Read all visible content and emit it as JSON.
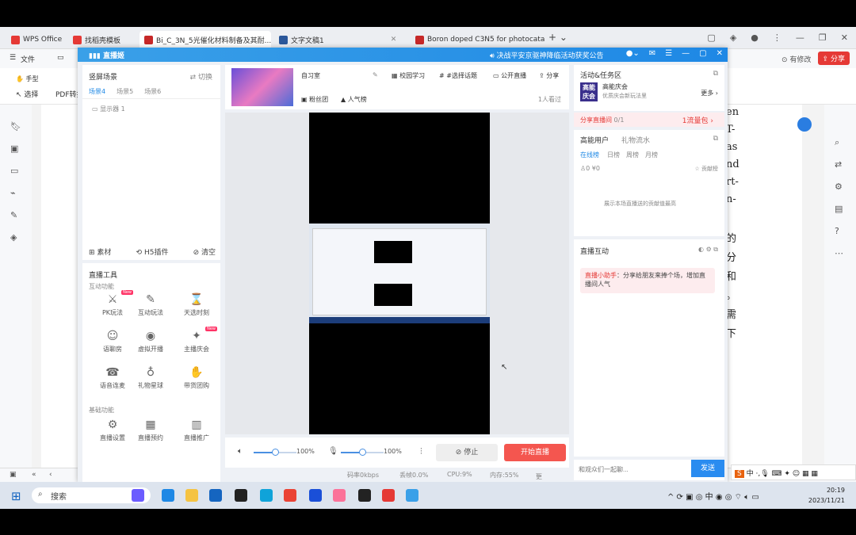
{
  "wps": {
    "tabs": [
      {
        "label": "WPS Office",
        "color": "#e53935"
      },
      {
        "label": "找稻壳模板",
        "color": "#e53935"
      },
      {
        "label": "Bi_C_3N_5光催化材料制备及其耐...",
        "color": "#c62828"
      },
      {
        "label": "文字文稿1",
        "color": "#2b579a"
      },
      {
        "label": "Boron doped C3N5 for photocata",
        "color": "#c62828"
      }
    ],
    "file_menu": "文件",
    "hand_tool": "手型",
    "select_tool": "选择",
    "pdf_convert": "PDF转换",
    "has_changes": "有修改",
    "share": "分享",
    "doc_fragments": [
      "en",
      "T-",
      "as",
      "nd",
      "rt-",
      "n-",
      "的",
      "分",
      "和",
      "。",
      "需",
      "下"
    ]
  },
  "live": {
    "app_title": "直播姬",
    "notice": "决战平安京驱神降临活动获奖公告",
    "scene": {
      "title": "竖屏场景",
      "switch": "切换",
      "tabs": [
        "场景4",
        "场景5",
        "场景6"
      ],
      "source": "显示器 1",
      "footer": [
        "素材",
        "H5插件",
        "清空"
      ]
    },
    "tools": {
      "title": "直播工具",
      "interactive_section": "互动功能",
      "basic_section": "基础功能",
      "items": [
        {
          "label": "PK玩法",
          "icon": "⚔",
          "new": true
        },
        {
          "label": "互动玩法",
          "icon": "✎",
          "new": false
        },
        {
          "label": "天选时刻",
          "icon": "⌛",
          "new": false
        },
        {
          "label": "语聊房",
          "icon": "☺",
          "new": false
        },
        {
          "label": "虚拟开播",
          "icon": "◉",
          "new": false
        },
        {
          "label": "主播庆会",
          "icon": "✦",
          "new": true
        },
        {
          "label": "语音连麦",
          "icon": "☎",
          "new": false
        },
        {
          "label": "礼物星球",
          "icon": "♁",
          "new": false
        },
        {
          "label": "带货团购",
          "icon": "✋",
          "new": false
        }
      ],
      "basic_items": [
        {
          "label": "直播设置",
          "icon": "⚙"
        },
        {
          "label": "直播预约",
          "icon": "▦"
        },
        {
          "label": "直播推广",
          "icon": "▥"
        }
      ]
    },
    "room": {
      "name": "自习室",
      "actions": [
        "校园学习",
        "#选择话题",
        "公开直播",
        "分享"
      ],
      "fan_group": "粉丝团",
      "popularity": "人气榜",
      "viewers": "1人看过"
    },
    "controls": {
      "speaker_vol": "100%",
      "mic_vol": "100%",
      "speaker_level": 0.5,
      "mic_level": 0.5,
      "stop": "停止",
      "start": "开始直播"
    },
    "stats": {
      "bitrate": "码率0kbps",
      "drop": "丢帧0.0%",
      "cpu": "CPU:9%",
      "mem": "内存:55%",
      "more": "更多详情"
    },
    "right": {
      "activity_title": "活动&任务区",
      "promo_badge": "高能庆会",
      "promo_title": "高能庆会",
      "promo_sub": "优质庆会新玩法里",
      "more": "更多",
      "share_room": "分享直播间",
      "share_count": "0/1",
      "flow_pack": "1流量包",
      "users_tabs": [
        "高能用户",
        "礼物流水"
      ],
      "rank_tabs": [
        "在线榜",
        "日榜",
        "周榜",
        "月榜"
      ],
      "counts": "0  ¥0",
      "fans_btn": "贡献榜",
      "empty_text": "展示本场直播送的贡献值最高",
      "interact_title": "直播互动",
      "tip_label": "直播小助手",
      "tip_text": "：分享给朋友来捧个场，增加直播间人气",
      "input_placeholder": "和观众们一起聊...",
      "send": "发送"
    }
  },
  "taskbar": {
    "search": "搜索",
    "ime": "中",
    "time": "20:19",
    "date": "2023/11/21",
    "apps": [
      {
        "name": "widgets",
        "color": "#6b5cff"
      },
      {
        "name": "edge",
        "color": "#1e88e5"
      },
      {
        "name": "explorer",
        "color": "#f5c342"
      },
      {
        "name": "mail",
        "color": "#1565c0"
      },
      {
        "name": "qq",
        "color": "#222222"
      },
      {
        "name": "edge2",
        "color": "#0fa3d9"
      },
      {
        "name": "chrome",
        "color": "#ea4335"
      },
      {
        "name": "app-l",
        "color": "#1a4fd8"
      },
      {
        "name": "bilibili",
        "color": "#fb7299"
      },
      {
        "name": "zy",
        "color": "#222222"
      },
      {
        "name": "wps",
        "color": "#e53935"
      },
      {
        "name": "live",
        "color": "#3aa0e8"
      }
    ]
  }
}
